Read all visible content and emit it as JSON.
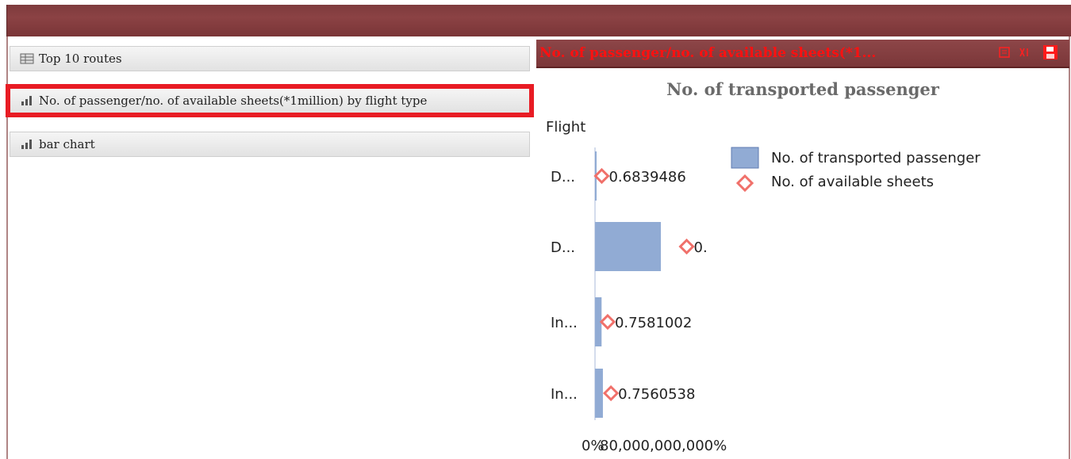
{
  "nav": {
    "items": [
      {
        "label": "Top 10 routes",
        "icon": "table-icon",
        "selected": false
      },
      {
        "label": "No. of passenger/no. of available sheets(*1million) by flight type",
        "icon": "bar-chart-icon",
        "selected": true
      },
      {
        "label": "bar chart",
        "icon": "bar-chart-icon",
        "selected": false
      }
    ]
  },
  "panel": {
    "title": "No. of passenger/no. of available sheets(*1...",
    "buttons": [
      "export-icon",
      "excel-icon",
      "save-icon"
    ],
    "accent_color": "#ff1010",
    "header_color": "#85403f"
  },
  "chart_data": {
    "type": "bar",
    "orientation": "horizontal",
    "title": "No. of transported passenger",
    "ylabel": "Flight",
    "categories": [
      "D...",
      "D...",
      "In...",
      "In..."
    ],
    "series": [
      {
        "name": "No. of transported passenger",
        "kind": "bar",
        "color": "#91abd4",
        "values": [
          0.02,
          1.0,
          0.1,
          0.12
        ]
      },
      {
        "name": "No. of available sheets",
        "kind": "marker",
        "color": "#f0706a",
        "values": [
          0.03,
          1.32,
          0.12,
          0.17
        ]
      }
    ],
    "data_labels": [
      "0.6839486",
      "0.",
      "0.7581002",
      "0.7560538"
    ],
    "x_tick_labels": [
      "0%",
      "80,000,000,000%"
    ],
    "legend_position": "top-right"
  }
}
